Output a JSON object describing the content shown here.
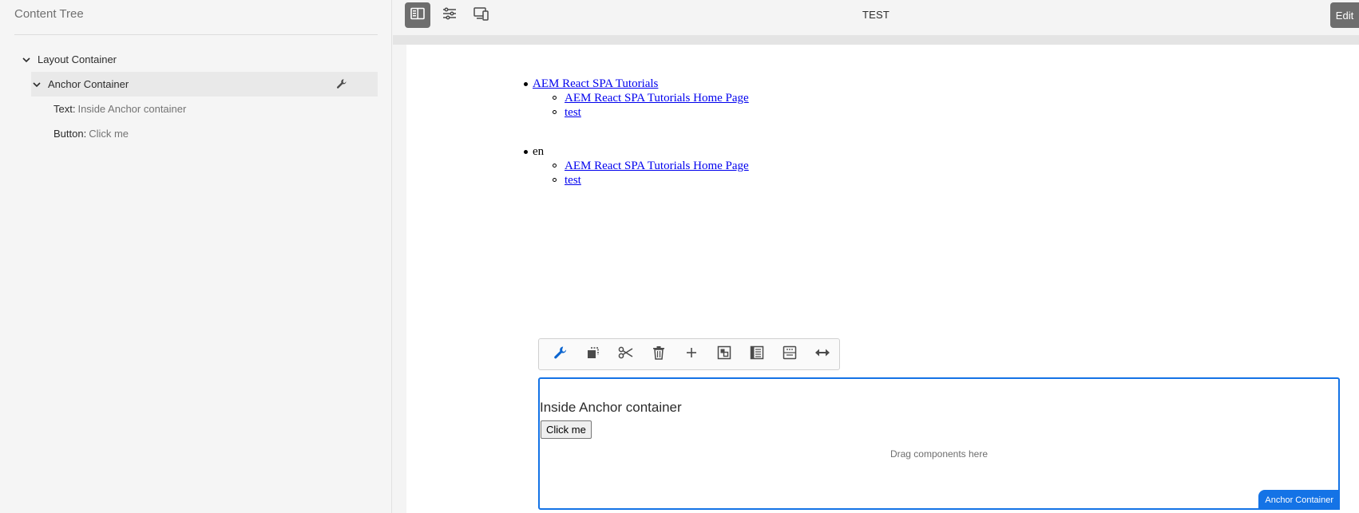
{
  "sidebar": {
    "title": "Content Tree",
    "items": [
      {
        "label": "Layout Container"
      },
      {
        "label": "Anchor Container"
      },
      {
        "key": "Text:",
        "value": "Inside Anchor container"
      },
      {
        "key": "Button:",
        "value": "Click me"
      }
    ]
  },
  "topbar": {
    "page_title": "TEST",
    "edit_label": "Edit",
    "icons": [
      "side-panel-icon",
      "page-properties-icon",
      "emulator-icon"
    ]
  },
  "page": {
    "nav1": {
      "top_link": "AEM React SPA Tutorials",
      "children": [
        "AEM React SPA Tutorials Home Page",
        "test"
      ]
    },
    "nav2": {
      "top_text": "en",
      "children": [
        "AEM React SPA Tutorials Home Page",
        "test"
      ]
    }
  },
  "edit_toolbar": {
    "icons": [
      "wrench-icon",
      "copy-icon",
      "cut-icon",
      "delete-icon",
      "insert-icon",
      "group-icon",
      "parent-icon",
      "layout-icon",
      "resize-icon"
    ]
  },
  "component": {
    "text": "Inside Anchor container",
    "button_label": "Click me",
    "placeholder": "Drag components here",
    "tag_label": "Anchor Container"
  },
  "colors": {
    "accent": "#1473e6",
    "selected_icon": "#0d66d0"
  }
}
